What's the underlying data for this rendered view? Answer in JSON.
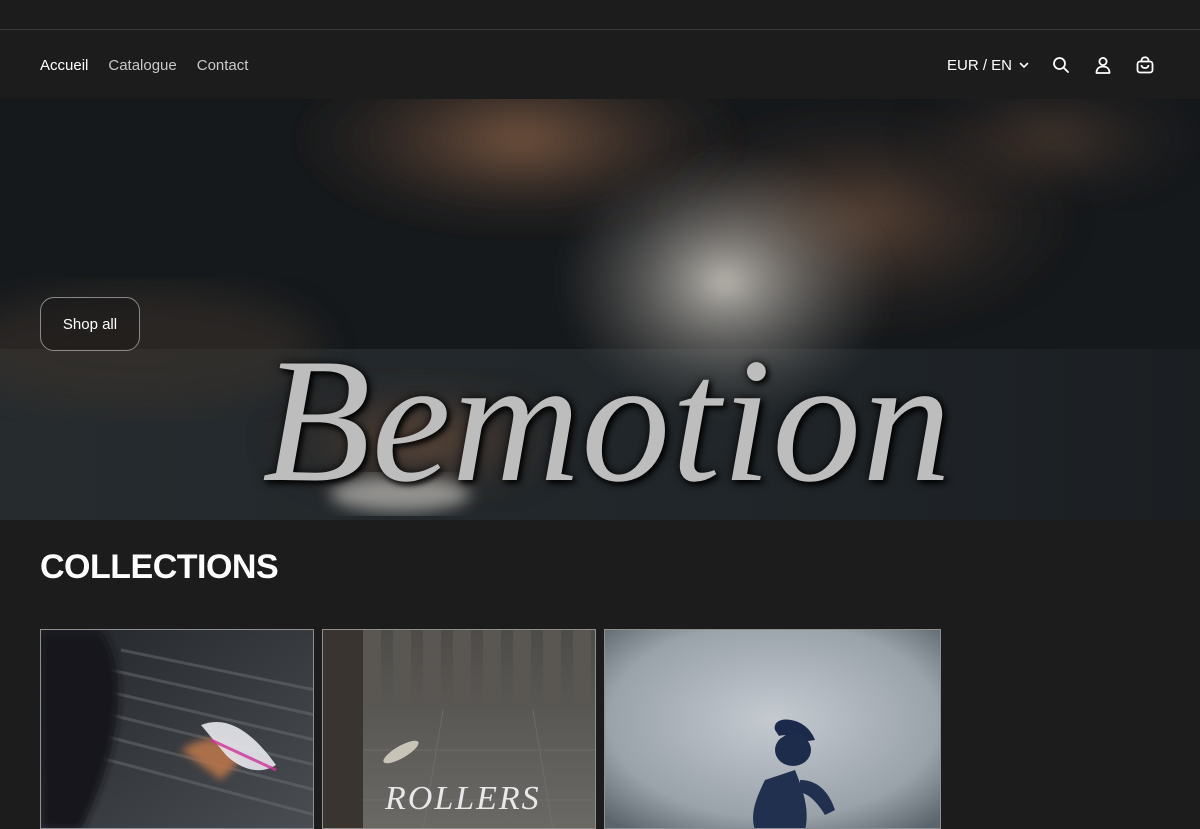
{
  "nav": {
    "items": [
      {
        "label": "Accueil",
        "active": true
      },
      {
        "label": "Catalogue",
        "active": false
      },
      {
        "label": "Contact",
        "active": false
      }
    ]
  },
  "header": {
    "locale": "EUR / EN",
    "icons": [
      "search-icon",
      "account-icon",
      "cart-icon"
    ]
  },
  "hero": {
    "title": "Bemotion",
    "cta_label": "Shop all"
  },
  "collections": {
    "heading": "COLLECTIONS",
    "cards": [
      {
        "label": ""
      },
      {
        "label": "ROLLERS"
      },
      {
        "label": ""
      }
    ]
  },
  "colors": {
    "background": "#1c1c1c",
    "text": "#ffffff",
    "muted_text": "#c9c9c9",
    "border": "#8f8f8f"
  }
}
